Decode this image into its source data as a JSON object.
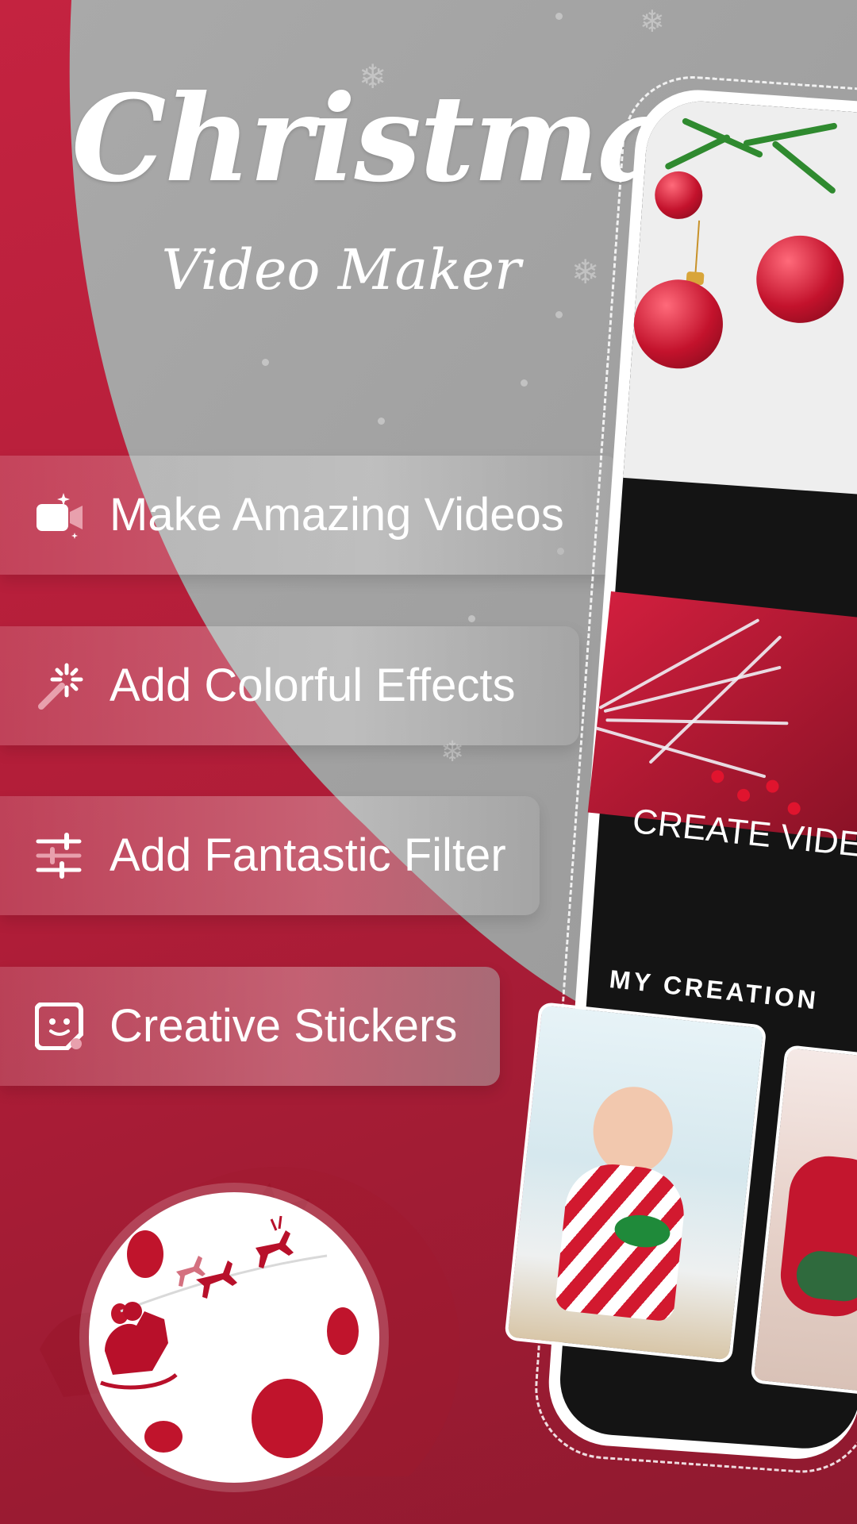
{
  "app": {
    "title": "Christmas",
    "subtitle": "Video Maker"
  },
  "features": [
    {
      "label": "Make Amazing Videos",
      "icon": "video-camera-icon"
    },
    {
      "label": "Add Colorful Effects",
      "icon": "magic-wand-icon"
    },
    {
      "label": "Add Fantastic Filter",
      "icon": "sliders-icon"
    },
    {
      "label": "Creative Stickers",
      "icon": "sticker-face-icon"
    }
  ],
  "phone": {
    "create_video_label": "CREATE VIDEO",
    "my_creation_label": "MY CREATION"
  },
  "colors": {
    "background_red": "#b31e39",
    "sweep_grey": "#a8a8a8",
    "phone_screen": "#141414",
    "ornament_red": "#c3122c"
  }
}
